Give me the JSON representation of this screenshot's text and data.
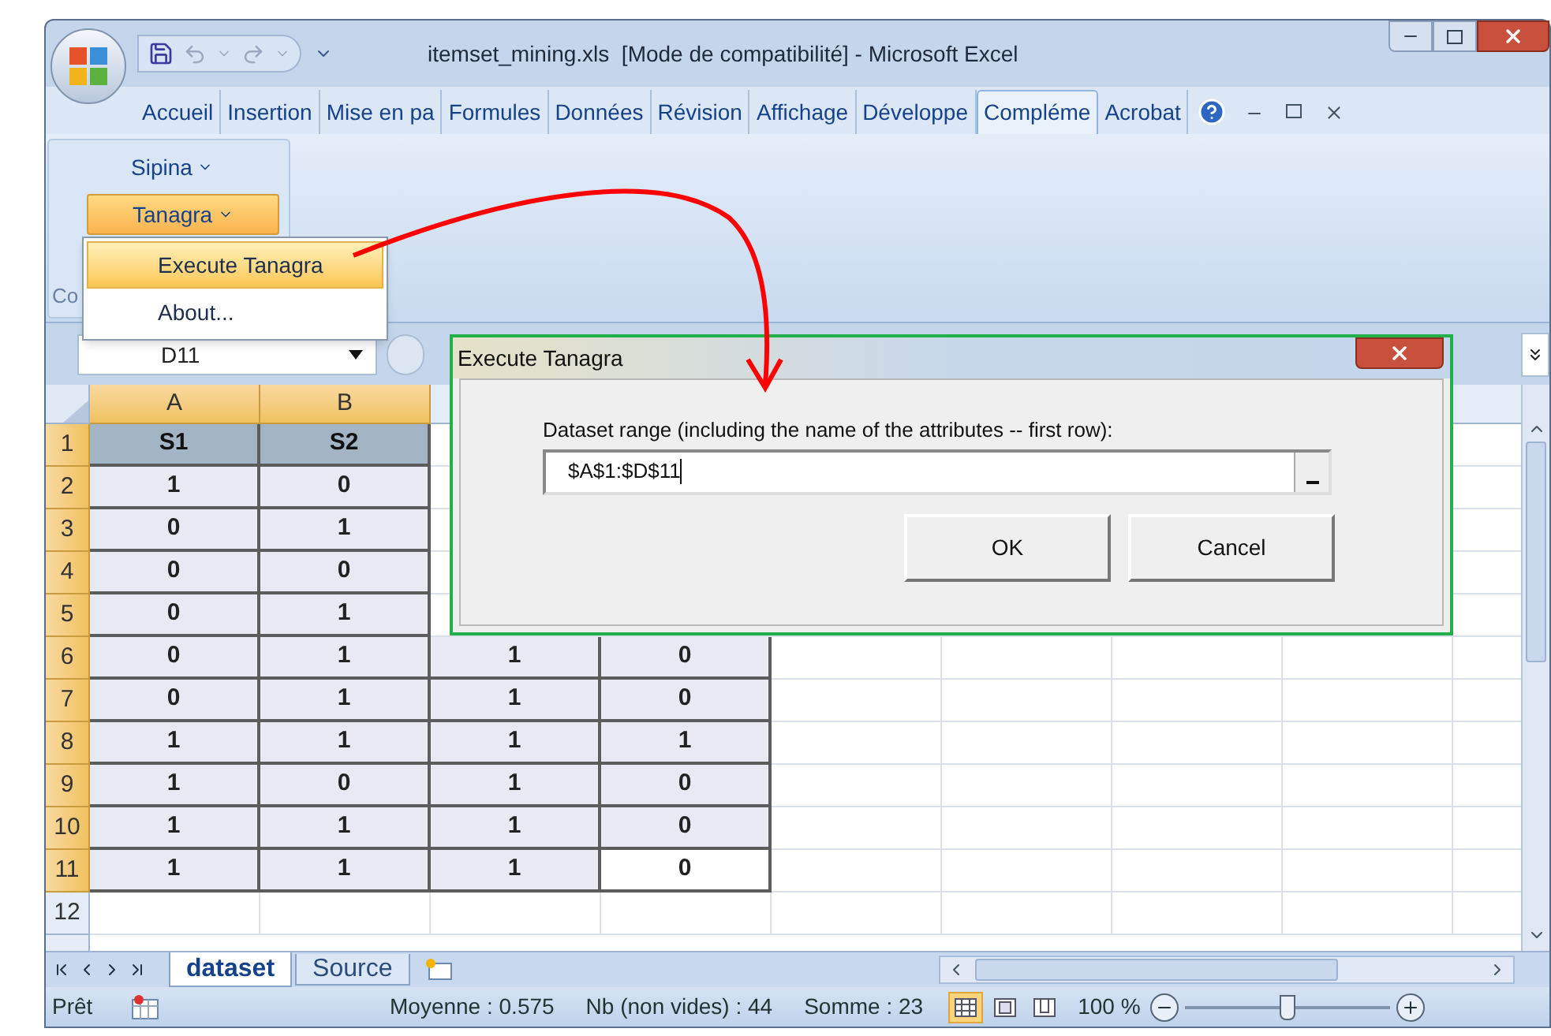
{
  "window": {
    "title": "itemset_mining.xls  [Mode de compatibilité] - Microsoft Excel"
  },
  "ribbon_tabs": [
    {
      "label": "Accueil",
      "selected": false
    },
    {
      "label": "Insertion",
      "selected": false
    },
    {
      "label": "Mise en pa",
      "selected": false
    },
    {
      "label": "Formules",
      "selected": false
    },
    {
      "label": "Données",
      "selected": false
    },
    {
      "label": "Révision",
      "selected": false
    },
    {
      "label": "Affichage",
      "selected": false
    },
    {
      "label": "Développe",
      "selected": false
    },
    {
      "label": "Compléme",
      "selected": true
    },
    {
      "label": "Acrobat",
      "selected": false
    }
  ],
  "ribbon": {
    "buttons": [
      {
        "label": "Sipina",
        "active": false
      },
      {
        "label": "Tanagra",
        "active": true
      }
    ],
    "group_label": "Co"
  },
  "menu": {
    "items": [
      {
        "label": "Execute Tanagra",
        "selected": true
      },
      {
        "label": "About...",
        "selected": false
      }
    ]
  },
  "formula_bar": {
    "name_box": "D11"
  },
  "sheet": {
    "columns": [
      {
        "label": "A",
        "selected": true
      },
      {
        "label": "B",
        "selected": true
      }
    ],
    "rows": [
      {
        "label": "1",
        "selected": true,
        "kind": "header",
        "cells": [
          {
            "value": "S1",
            "selected": false
          },
          {
            "value": "S2",
            "selected": false
          }
        ]
      },
      {
        "label": "2",
        "selected": true,
        "kind": "data",
        "cells": [
          {
            "value": "1",
            "selected": false
          },
          {
            "value": "0",
            "selected": false
          }
        ]
      },
      {
        "label": "3",
        "selected": true,
        "kind": "data",
        "cells": [
          {
            "value": "0",
            "selected": false
          },
          {
            "value": "1",
            "selected": false
          }
        ]
      },
      {
        "label": "4",
        "selected": true,
        "kind": "data",
        "cells": [
          {
            "value": "0",
            "selected": false
          },
          {
            "value": "0",
            "selected": false
          }
        ]
      },
      {
        "label": "5",
        "selected": true,
        "kind": "data",
        "cells": [
          {
            "value": "0",
            "selected": false
          },
          {
            "value": "1",
            "selected": false
          }
        ]
      },
      {
        "label": "6",
        "selected": true,
        "kind": "data",
        "cells": [
          {
            "value": "0",
            "selected": false
          },
          {
            "value": "1",
            "selected": false
          },
          {
            "value": "1",
            "selected": false
          },
          {
            "value": "0",
            "selected": false
          }
        ]
      },
      {
        "label": "7",
        "selected": true,
        "kind": "data",
        "cells": [
          {
            "value": "0",
            "selected": false
          },
          {
            "value": "1",
            "selected": false
          },
          {
            "value": "1",
            "selected": false
          },
          {
            "value": "0",
            "selected": false
          }
        ]
      },
      {
        "label": "8",
        "selected": true,
        "kind": "data",
        "cells": [
          {
            "value": "1",
            "selected": false
          },
          {
            "value": "1",
            "selected": false
          },
          {
            "value": "1",
            "selected": false
          },
          {
            "value": "1",
            "selected": false
          }
        ]
      },
      {
        "label": "9",
        "selected": true,
        "kind": "data",
        "cells": [
          {
            "value": "1",
            "selected": false
          },
          {
            "value": "0",
            "selected": false
          },
          {
            "value": "1",
            "selected": false
          },
          {
            "value": "0",
            "selected": false
          }
        ]
      },
      {
        "label": "10",
        "selected": true,
        "kind": "data",
        "cells": [
          {
            "value": "1",
            "selected": false
          },
          {
            "value": "1",
            "selected": false
          },
          {
            "value": "1",
            "selected": false
          },
          {
            "value": "0",
            "selected": false
          }
        ]
      },
      {
        "label": "11",
        "selected": true,
        "kind": "data",
        "cells": [
          {
            "value": "1",
            "selected": false
          },
          {
            "value": "1",
            "selected": false
          },
          {
            "value": "1",
            "selected": false
          },
          {
            "value": "0",
            "selected": true
          }
        ]
      },
      {
        "label": "12",
        "selected": false,
        "kind": "data",
        "cells": []
      }
    ]
  },
  "dialog": {
    "title": "Execute Tanagra",
    "label": "Dataset range (including the name of the attributes -- first row):",
    "range": "$A$1:$D$11",
    "buttons": [
      "OK",
      "Cancel"
    ]
  },
  "sheet_tabs": [
    {
      "label": "dataset",
      "selected": true
    },
    {
      "label": "Source",
      "selected": false
    }
  ],
  "status_bar": {
    "mode": "Prêt",
    "average": "Moyenne : 0.575",
    "count": "Nb (non vides) : 44",
    "sum": "Somme : 23",
    "views": [
      {
        "kind": "normal",
        "selected": true
      },
      {
        "kind": "layout",
        "selected": false
      },
      {
        "kind": "breaks",
        "selected": false
      }
    ],
    "zoom": "100 %",
    "zoom_slider": {
      "level": 0.5
    }
  }
}
